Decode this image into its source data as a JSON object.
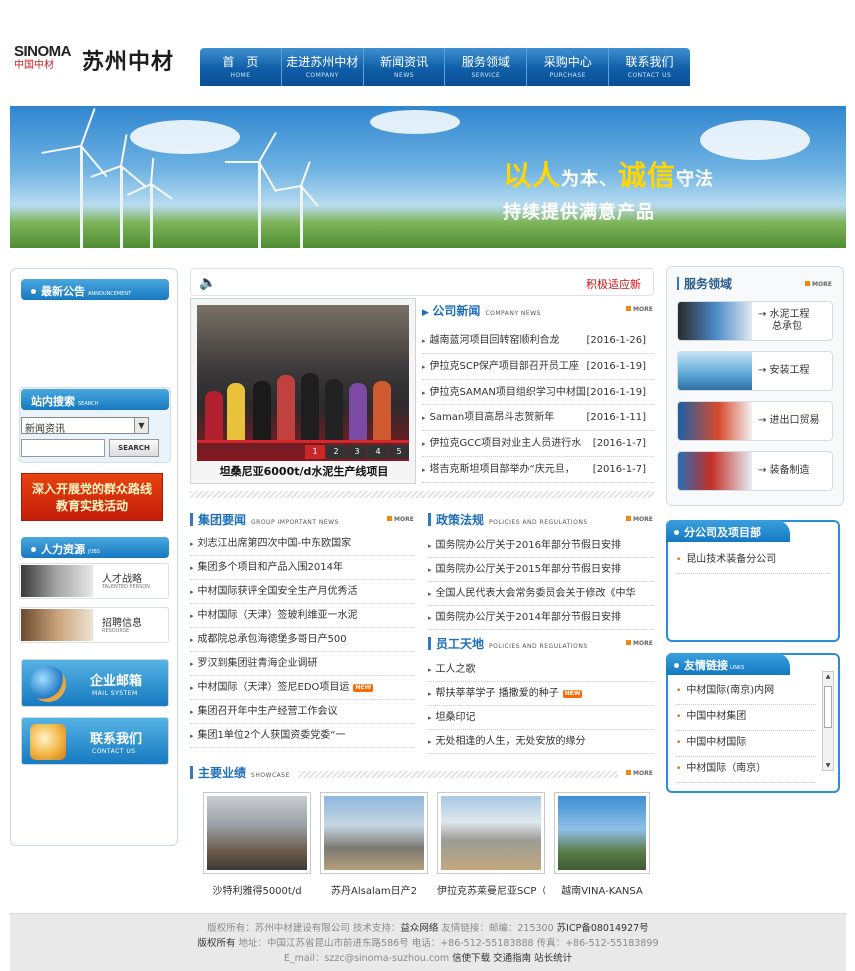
{
  "header": {
    "brand_en": "SINOMA",
    "brand_cn": "中国中材",
    "site_name": "苏州中材"
  },
  "nav": [
    {
      "cn": "首　页",
      "en": "HOME"
    },
    {
      "cn": "走进苏州中材",
      "en": "COMPANY"
    },
    {
      "cn": "新闻资讯",
      "en": "NEWS"
    },
    {
      "cn": "服务领域",
      "en": "SERVICE"
    },
    {
      "cn": "采购中心",
      "en": "PURCHASE"
    },
    {
      "cn": "联系我们",
      "en": "CONTACT US"
    }
  ],
  "banner": {
    "slogan_y1": "以人",
    "slogan_w1": "为本、",
    "slogan_y2": "诚信",
    "slogan_w2": "守法",
    "slogan_line2": "持续提供满意产品"
  },
  "left": {
    "announcement": {
      "title": "最新公告",
      "en": "ANNOUNCEMENT"
    },
    "search": {
      "title": "站内搜索",
      "en": "SEARCH",
      "select_value": "新闻资讯",
      "button": "SEARCH"
    },
    "party_banner": {
      "line1": "深入开展党的群众路线",
      "line2": "教育实践活动"
    },
    "hr": {
      "title": "人力资源",
      "en": "JOBS",
      "items": [
        {
          "cn": "人才战略",
          "en": "TALENTED PERSON"
        },
        {
          "cn": "招聘信息",
          "en": "RESOURSE"
        }
      ]
    },
    "mail": {
      "cn": "企业邮箱",
      "en": "MAIL SYSTEM"
    },
    "contact": {
      "cn": "联系我们",
      "en": "CONTACT US"
    }
  },
  "ticker": {
    "text": "积极适应新"
  },
  "slideshow": {
    "caption": "坦桑尼亚6000t/d水泥生产线项目",
    "pages": [
      "1",
      "2",
      "3",
      "4",
      "5"
    ]
  },
  "company_news": {
    "title": "公司新闻",
    "en": "COMPANY NEWS",
    "more": "MORE",
    "items": [
      {
        "title": "越南蓝河项目回转窑顺利合龙",
        "date": "[2016-1-26]"
      },
      {
        "title": "伊拉克SCP保产项目部召开员工座",
        "date": "[2016-1-19]"
      },
      {
        "title": "伊拉克SAMAN项目组织学习中材国",
        "date": "[2016-1-19]"
      },
      {
        "title": "Saman项目高昂斗志贺新年",
        "date": "[2016-1-11]"
      },
      {
        "title": "伊拉克GCC项目对业主人员进行水",
        "date": "[2016-1-7]"
      },
      {
        "title": "塔吉克斯坦项目部举办“庆元旦，",
        "date": "[2016-1-7]"
      }
    ]
  },
  "group_news": {
    "title": "集团要闻",
    "en": "GROUP IMPORTANT NEWS",
    "more": "MORE",
    "items": [
      {
        "title": "刘志江出席第四次中国-中东欧国家",
        "new": ""
      },
      {
        "title": "集团多个项目和产品入围2014年",
        "new": ""
      },
      {
        "title": "中材国际获评全国安全生产月优秀活",
        "new": ""
      },
      {
        "title": "中材国际（天津）签玻利维亚一水泥",
        "new": ""
      },
      {
        "title": "成都院总承包海德堡多哥日产500",
        "new": ""
      },
      {
        "title": "罗汉到集团驻青海企业调研",
        "new": ""
      },
      {
        "title": "中材国际（天津）签尼EDO项目运",
        "new": "NEW"
      },
      {
        "title": "集团召开年中生产经营工作会议",
        "new": ""
      },
      {
        "title": "集团1单位2个人获国资委党委“一",
        "new": ""
      }
    ]
  },
  "policy": {
    "title": "政策法规",
    "en": "POLICIES AND REGULATIONS",
    "more": "MORE",
    "items": [
      {
        "title": "国务院办公厅关于2016年部分节假日安排"
      },
      {
        "title": "国务院办公厅关于2015年部分节假日安排"
      },
      {
        "title": "全国人民代表大会常务委员会关于修改《中华"
      },
      {
        "title": "国务院办公厅关于2014年部分节假日安排"
      }
    ]
  },
  "staff": {
    "title": "员工天地",
    "en": "POLICIES AND REGULATIONS",
    "more": "MORE",
    "items": [
      {
        "title": "工人之歌",
        "new": ""
      },
      {
        "title": "帮扶莘莘学子  播撒爱的种子",
        "new": "NEW"
      },
      {
        "title": "坦桑印记",
        "new": ""
      },
      {
        "title": "无处相逢的人生，无处安放的缘分",
        "new": ""
      }
    ]
  },
  "showcase": {
    "title": "主要业绩",
    "en": "SHOWCASE",
    "more": "MORE",
    "items": [
      {
        "caption": "沙特利雅得5000t/d"
      },
      {
        "caption": "苏丹Alsalam日产2"
      },
      {
        "caption": "伊拉克苏莱曼尼亚SCP（"
      },
      {
        "caption": "越南VINA-KANSA"
      }
    ]
  },
  "services": {
    "title": "服务领域",
    "more": "MORE",
    "items": [
      {
        "line1": "→ 水泥工程",
        "line2": "总承包"
      },
      {
        "line1": "→ 安装工程",
        "line2": ""
      },
      {
        "line1": "→ 进出口贸易",
        "line2": ""
      },
      {
        "line1": "→ 装备制造",
        "line2": ""
      }
    ]
  },
  "branches": {
    "title": "分公司及项目部",
    "items": [
      "昆山技术装备分公司"
    ]
  },
  "links": {
    "title": "友情链接",
    "en": "LINKS",
    "items": [
      "中材国际(南京)内网",
      "中国中材集团",
      "中国中材国际",
      "中材国际（南京）"
    ]
  },
  "footer": {
    "line1_a": "版权所有：苏州中材建设有限公司  技术支持：",
    "line1_b": "益众网络",
    "line1_c": "  友情链接：邮编：215300  ",
    "line1_d": "苏ICP备08014927号",
    "line2_a": "版权所有",
    "line2_b": "  地址：中国江苏省昆山市前进东路586号  电话：+86-512-55183888  传真：+86-512-55183899",
    "line3_a": "E_mail：szzc@sinoma-suzhou.com ",
    "line3_b": "信使下载  交通指南  站长统计"
  },
  "colors": {
    "nav_blue": "#0f5ea8",
    "accent_orange": "#f08a00",
    "ticker_red": "#d21010"
  }
}
